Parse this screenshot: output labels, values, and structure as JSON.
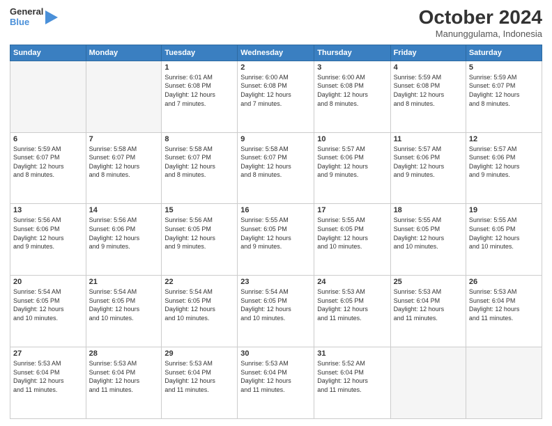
{
  "header": {
    "logo_line1": "General",
    "logo_line2": "Blue",
    "month": "October 2024",
    "location": "Manunggulama, Indonesia"
  },
  "weekdays": [
    "Sunday",
    "Monday",
    "Tuesday",
    "Wednesday",
    "Thursday",
    "Friday",
    "Saturday"
  ],
  "weeks": [
    [
      {
        "day": "",
        "info": ""
      },
      {
        "day": "",
        "info": ""
      },
      {
        "day": "1",
        "info": "Sunrise: 6:01 AM\nSunset: 6:08 PM\nDaylight: 12 hours\nand 7 minutes."
      },
      {
        "day": "2",
        "info": "Sunrise: 6:00 AM\nSunset: 6:08 PM\nDaylight: 12 hours\nand 7 minutes."
      },
      {
        "day": "3",
        "info": "Sunrise: 6:00 AM\nSunset: 6:08 PM\nDaylight: 12 hours\nand 8 minutes."
      },
      {
        "day": "4",
        "info": "Sunrise: 5:59 AM\nSunset: 6:08 PM\nDaylight: 12 hours\nand 8 minutes."
      },
      {
        "day": "5",
        "info": "Sunrise: 5:59 AM\nSunset: 6:07 PM\nDaylight: 12 hours\nand 8 minutes."
      }
    ],
    [
      {
        "day": "6",
        "info": "Sunrise: 5:59 AM\nSunset: 6:07 PM\nDaylight: 12 hours\nand 8 minutes."
      },
      {
        "day": "7",
        "info": "Sunrise: 5:58 AM\nSunset: 6:07 PM\nDaylight: 12 hours\nand 8 minutes."
      },
      {
        "day": "8",
        "info": "Sunrise: 5:58 AM\nSunset: 6:07 PM\nDaylight: 12 hours\nand 8 minutes."
      },
      {
        "day": "9",
        "info": "Sunrise: 5:58 AM\nSunset: 6:07 PM\nDaylight: 12 hours\nand 8 minutes."
      },
      {
        "day": "10",
        "info": "Sunrise: 5:57 AM\nSunset: 6:06 PM\nDaylight: 12 hours\nand 9 minutes."
      },
      {
        "day": "11",
        "info": "Sunrise: 5:57 AM\nSunset: 6:06 PM\nDaylight: 12 hours\nand 9 minutes."
      },
      {
        "day": "12",
        "info": "Sunrise: 5:57 AM\nSunset: 6:06 PM\nDaylight: 12 hours\nand 9 minutes."
      }
    ],
    [
      {
        "day": "13",
        "info": "Sunrise: 5:56 AM\nSunset: 6:06 PM\nDaylight: 12 hours\nand 9 minutes."
      },
      {
        "day": "14",
        "info": "Sunrise: 5:56 AM\nSunset: 6:06 PM\nDaylight: 12 hours\nand 9 minutes."
      },
      {
        "day": "15",
        "info": "Sunrise: 5:56 AM\nSunset: 6:05 PM\nDaylight: 12 hours\nand 9 minutes."
      },
      {
        "day": "16",
        "info": "Sunrise: 5:55 AM\nSunset: 6:05 PM\nDaylight: 12 hours\nand 9 minutes."
      },
      {
        "day": "17",
        "info": "Sunrise: 5:55 AM\nSunset: 6:05 PM\nDaylight: 12 hours\nand 10 minutes."
      },
      {
        "day": "18",
        "info": "Sunrise: 5:55 AM\nSunset: 6:05 PM\nDaylight: 12 hours\nand 10 minutes."
      },
      {
        "day": "19",
        "info": "Sunrise: 5:55 AM\nSunset: 6:05 PM\nDaylight: 12 hours\nand 10 minutes."
      }
    ],
    [
      {
        "day": "20",
        "info": "Sunrise: 5:54 AM\nSunset: 6:05 PM\nDaylight: 12 hours\nand 10 minutes."
      },
      {
        "day": "21",
        "info": "Sunrise: 5:54 AM\nSunset: 6:05 PM\nDaylight: 12 hours\nand 10 minutes."
      },
      {
        "day": "22",
        "info": "Sunrise: 5:54 AM\nSunset: 6:05 PM\nDaylight: 12 hours\nand 10 minutes."
      },
      {
        "day": "23",
        "info": "Sunrise: 5:54 AM\nSunset: 6:05 PM\nDaylight: 12 hours\nand 10 minutes."
      },
      {
        "day": "24",
        "info": "Sunrise: 5:53 AM\nSunset: 6:05 PM\nDaylight: 12 hours\nand 11 minutes."
      },
      {
        "day": "25",
        "info": "Sunrise: 5:53 AM\nSunset: 6:04 PM\nDaylight: 12 hours\nand 11 minutes."
      },
      {
        "day": "26",
        "info": "Sunrise: 5:53 AM\nSunset: 6:04 PM\nDaylight: 12 hours\nand 11 minutes."
      }
    ],
    [
      {
        "day": "27",
        "info": "Sunrise: 5:53 AM\nSunset: 6:04 PM\nDaylight: 12 hours\nand 11 minutes."
      },
      {
        "day": "28",
        "info": "Sunrise: 5:53 AM\nSunset: 6:04 PM\nDaylight: 12 hours\nand 11 minutes."
      },
      {
        "day": "29",
        "info": "Sunrise: 5:53 AM\nSunset: 6:04 PM\nDaylight: 12 hours\nand 11 minutes."
      },
      {
        "day": "30",
        "info": "Sunrise: 5:53 AM\nSunset: 6:04 PM\nDaylight: 12 hours\nand 11 minutes."
      },
      {
        "day": "31",
        "info": "Sunrise: 5:52 AM\nSunset: 6:04 PM\nDaylight: 12 hours\nand 11 minutes."
      },
      {
        "day": "",
        "info": ""
      },
      {
        "day": "",
        "info": ""
      }
    ]
  ]
}
